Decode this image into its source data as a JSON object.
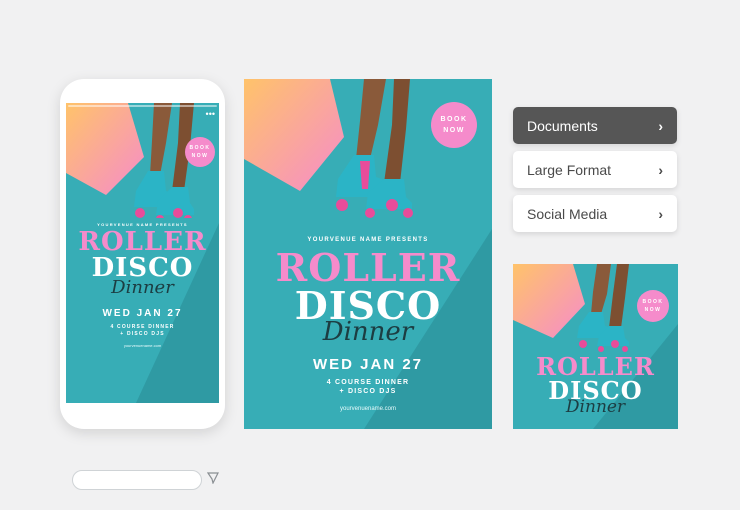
{
  "poster": {
    "book_line1": "BOOK",
    "book_line2": "NOW",
    "presents": "YOURVENUE NAME PRESENTS",
    "roller": "ROLLER",
    "disco": "DISCO",
    "dinner": "Dinner",
    "date": "WED JAN 27",
    "line1": "4 COURSE DINNER",
    "line2": "+ DISCO DJS",
    "website": "yourvenuename.com"
  },
  "menu": {
    "items": [
      {
        "label": "Documents",
        "active": true
      },
      {
        "label": "Large Format",
        "active": false
      },
      {
        "label": "Social Media",
        "active": false
      }
    ]
  },
  "colors": {
    "teal": "#37adb6",
    "pink": "#f58bcb",
    "skate": "#2bb4c6",
    "menu_active": "#565656"
  },
  "icons": {
    "chevron": "chevron-right-icon",
    "send": "send-icon",
    "more": "more-dots-icon"
  }
}
